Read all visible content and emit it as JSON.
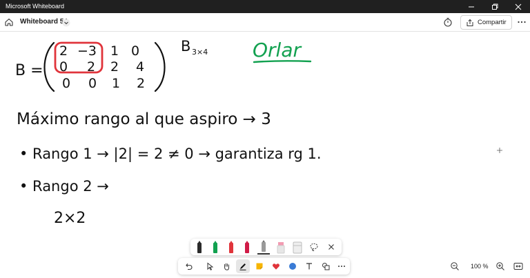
{
  "window": {
    "title": "Microsoft Whiteboard",
    "controls": [
      "minimize-icon",
      "restore-icon",
      "close-icon"
    ]
  },
  "appbar": {
    "board_title": "Whiteboard 54",
    "share_label": "Compartir",
    "icons": [
      "home-icon",
      "chevron-down-icon",
      "timer-icon",
      "share-icon",
      "more-icon"
    ]
  },
  "pen_tray": {
    "pens": [
      {
        "name": "black-pen",
        "color": "#2b2b2b"
      },
      {
        "name": "green-pen",
        "color": "#12a150"
      },
      {
        "name": "red-pen",
        "color": "#e0343b"
      },
      {
        "name": "crimson-pen",
        "color": "#d01b47"
      },
      {
        "name": "pencil",
        "color": "#9a9a9a"
      },
      {
        "name": "pink-highlighter",
        "color": "#f29bb2"
      },
      {
        "name": "eraser",
        "color": "#cfcfcf"
      }
    ],
    "icons": [
      "lasso-icon",
      "close-icon"
    ]
  },
  "tools": {
    "items": [
      "undo-icon",
      "select-icon",
      "hand-icon",
      "ink-icon",
      "sticky-note-icon",
      "reaction-icon",
      "shapes-icon",
      "text-icon",
      "image-icon",
      "more-tools-icon"
    ],
    "active": "ink-icon"
  },
  "zoom": {
    "value": "100 %",
    "icons": [
      "zoom-out-icon",
      "zoom-in-icon",
      "fit-screen-icon"
    ]
  },
  "ink": {
    "colors": {
      "black": "#111111",
      "red": "#e0343b",
      "green": "#12a150"
    },
    "matrix_label": "B =",
    "matrix_rows": [
      [
        "2",
        "−3",
        "1",
        "0"
      ],
      [
        "0",
        "2",
        "2",
        "4"
      ],
      [
        "0",
        "0",
        "1",
        "2"
      ]
    ],
    "dimension_base": "B",
    "dimension_subscript": "3×4",
    "keyword": "Orlar",
    "line1": "Máximo rango al que aspiro → 3",
    "line2": "• Rango 1 → |2| = 2 ≠ 0 → garantiza rg 1.",
    "line3": "• Rango 2 →",
    "line4": "2×2"
  }
}
